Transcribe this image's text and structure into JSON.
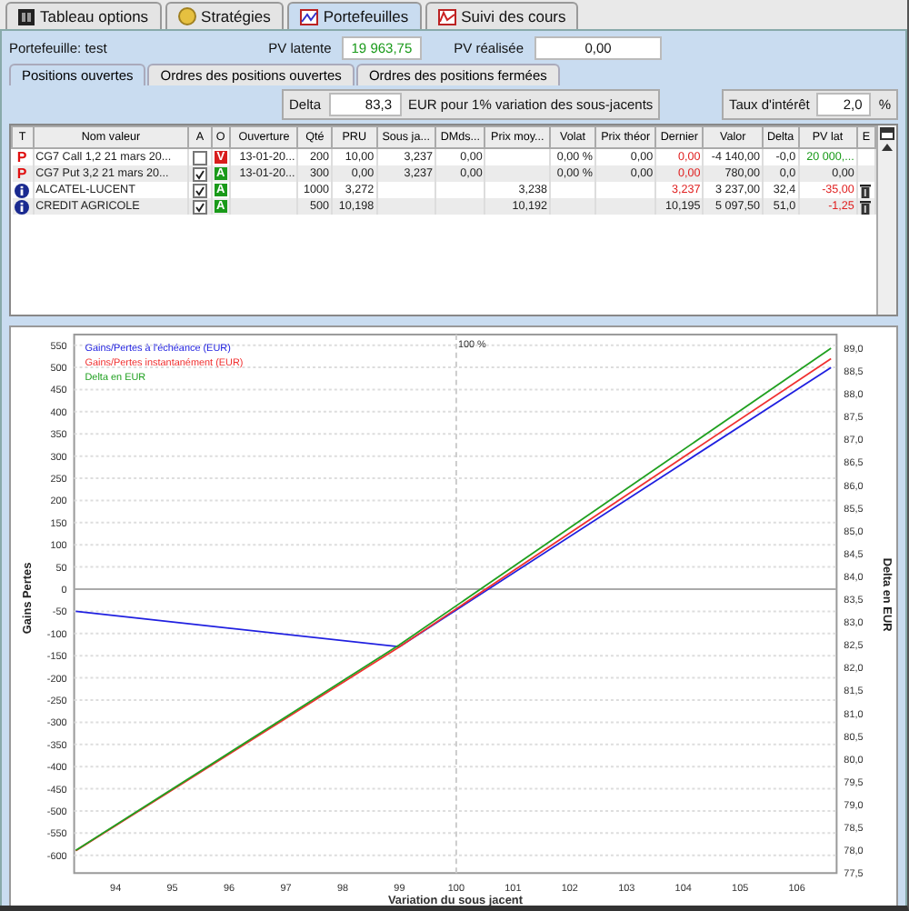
{
  "main_tabs": [
    {
      "label": "Tableau options",
      "selected": false
    },
    {
      "label": "Stratégies",
      "selected": false
    },
    {
      "label": "Portefeuilles",
      "selected": true
    },
    {
      "label": "Suivi des cours",
      "selected": false
    }
  ],
  "portfolio": {
    "name": "Portefeuille: test",
    "pv_latente_label": "PV latente",
    "pv_latente": "19 963,75",
    "pv_realisee_label": "PV réalisée",
    "pv_realisee": "0,00"
  },
  "sub_tabs": [
    {
      "label": "Positions ouvertes",
      "selected": true
    },
    {
      "label": "Ordres des positions ouvertes",
      "selected": false
    },
    {
      "label": "Ordres des positions fermées",
      "selected": false
    }
  ],
  "delta": {
    "label": "Delta",
    "value": "83,3",
    "suffix": "EUR pour 1% variation des sous-jacents"
  },
  "interest": {
    "label": "Taux d'intérêt",
    "value": "2,0",
    "unit": "%"
  },
  "table": {
    "columns": [
      "T",
      "Nom valeur",
      "A",
      "O",
      "Ouverture",
      "Qté",
      "PRU",
      "Sous ja...",
      "DMds...",
      "Prix moy...",
      "Volat",
      "Prix théor",
      "Dernier",
      "Valor",
      "Delta",
      "PV lat",
      "E"
    ],
    "rows": [
      {
        "kind": "option",
        "t": "P",
        "name": "CG7 Call 1,2 21 mars 20...",
        "a_checked": false,
        "o": {
          "text": "V",
          "color": "#d81c1c"
        },
        "ouverture": "13-01-20...",
        "qte": "200",
        "pru": "10,00",
        "sous_ja": "3,237",
        "dmds": "0,00",
        "prix_moy": "",
        "volat": "0,00 %",
        "prix_theor": "0,00",
        "dernier": {
          "text": "0,00",
          "color": "#e02020"
        },
        "valor": "-4 140,00",
        "delta": "-0,0",
        "pv_lat": {
          "text": "20 000,...",
          "color": "#1a9a1a"
        },
        "deletable": false
      },
      {
        "kind": "option",
        "t": "P",
        "name": "CG7 Put 3,2 21 mars 20...",
        "a_checked": true,
        "o": {
          "text": "A",
          "color": "#1a9a1a"
        },
        "ouverture": "13-01-20...",
        "qte": "300",
        "pru": "0,00",
        "sous_ja": "3,237",
        "dmds": "0,00",
        "prix_moy": "",
        "volat": "0,00 %",
        "prix_theor": "0,00",
        "dernier": {
          "text": "0,00",
          "color": "#e02020"
        },
        "valor": "780,00",
        "delta": "0,0",
        "pv_lat": {
          "text": "0,00",
          "color": "#222222"
        },
        "deletable": false
      },
      {
        "kind": "stock",
        "name": "ALCATEL-LUCENT",
        "a_checked": true,
        "o": {
          "text": "A",
          "color": "#1a9a1a"
        },
        "ouverture": "",
        "qte": "1000",
        "pru": "3,272",
        "sous_ja": "",
        "dmds": "",
        "prix_moy": "3,238",
        "volat": "",
        "prix_theor": "",
        "dernier": {
          "text": "3,237",
          "color": "#e02020"
        },
        "valor": "3 237,00",
        "delta": "32,4",
        "pv_lat": {
          "text": "-35,00",
          "color": "#e02020"
        },
        "deletable": true
      },
      {
        "kind": "stock",
        "name": "CREDIT AGRICOLE",
        "a_checked": true,
        "o": {
          "text": "A",
          "color": "#1a9a1a"
        },
        "ouverture": "",
        "qte": "500",
        "pru": "10,198",
        "sous_ja": "",
        "dmds": "",
        "prix_moy": "10,192",
        "volat": "",
        "prix_theor": "",
        "dernier": {
          "text": "10,195",
          "color": "#222222"
        },
        "valor": "5 097,50",
        "delta": "51,0",
        "pv_lat": {
          "text": "-1,25",
          "color": "#e02020"
        },
        "deletable": true
      }
    ]
  },
  "chart": {
    "chart_data": {
      "type": "line",
      "xlabel": "Variation du sous jacent",
      "ylabel": "Gains Pertes",
      "y2label": "Delta en EUR",
      "grid": true,
      "ref_lines": [
        {
          "axis": "x",
          "value": 100,
          "label": "100 %"
        }
      ],
      "y2lim": [
        77.5,
        89.3
      ],
      "y2ticks": [
        {
          "value": 89,
          "label": "89,0"
        },
        {
          "value": 88.5,
          "label": "88,5"
        },
        {
          "value": 88,
          "label": "88,0"
        },
        {
          "value": 87.5,
          "label": "87,5"
        },
        {
          "value": 87,
          "label": "87,0"
        },
        {
          "value": 86.5,
          "label": "86,5"
        },
        {
          "value": 86,
          "label": "86,0"
        },
        {
          "value": 85.5,
          "label": "85,5"
        },
        {
          "value": 85,
          "label": "85,0"
        },
        {
          "value": 84.5,
          "label": "84,5"
        },
        {
          "value": 84,
          "label": "84,0"
        },
        {
          "value": 83.5,
          "label": "83,5"
        },
        {
          "value": 83,
          "label": "83,0"
        },
        {
          "value": 82.5,
          "label": "82,5"
        },
        {
          "value": 82,
          "label": "82,0"
        },
        {
          "value": 81.5,
          "label": "81,5"
        },
        {
          "value": 81,
          "label": "81,0"
        },
        {
          "value": 80.5,
          "label": "80,5"
        },
        {
          "value": 80,
          "label": "80,0"
        },
        {
          "value": 79.5,
          "label": "79,5"
        },
        {
          "value": 79,
          "label": "79,0"
        },
        {
          "value": 78.5,
          "label": "78,5"
        },
        {
          "value": 78,
          "label": "78,0"
        },
        {
          "value": 77.5,
          "label": "77,5"
        }
      ],
      "x": [
        93.3,
        99,
        106.6
      ],
      "series": [
        {
          "name": "Gains/Pertes à l'échéance (EUR)",
          "color": "#2020e0",
          "values": [
            -50,
            -130,
            500
          ]
        },
        {
          "name": "Gains/Pertes instantanément (EUR)",
          "color": "#f03030",
          "values": [
            -590,
            -130,
            520
          ]
        },
        {
          "name": "Delta en EUR",
          "color": "#20a020",
          "axis": "y2",
          "values": [
            78,
            82.5,
            89
          ]
        }
      ],
      "xlim": [
        93.27,
        106.7
      ],
      "ylim": [
        -640,
        574
      ],
      "xticks": [
        94,
        95,
        96,
        97,
        98,
        99,
        100,
        101,
        102,
        103,
        104,
        105,
        106
      ],
      "yticks": [
        -600,
        -550,
        -500,
        -450,
        -400,
        -350,
        -300,
        -250,
        -200,
        -150,
        -100,
        -50,
        0,
        50,
        100,
        150,
        200,
        250,
        300,
        350,
        400,
        450,
        500,
        550
      ]
    }
  }
}
